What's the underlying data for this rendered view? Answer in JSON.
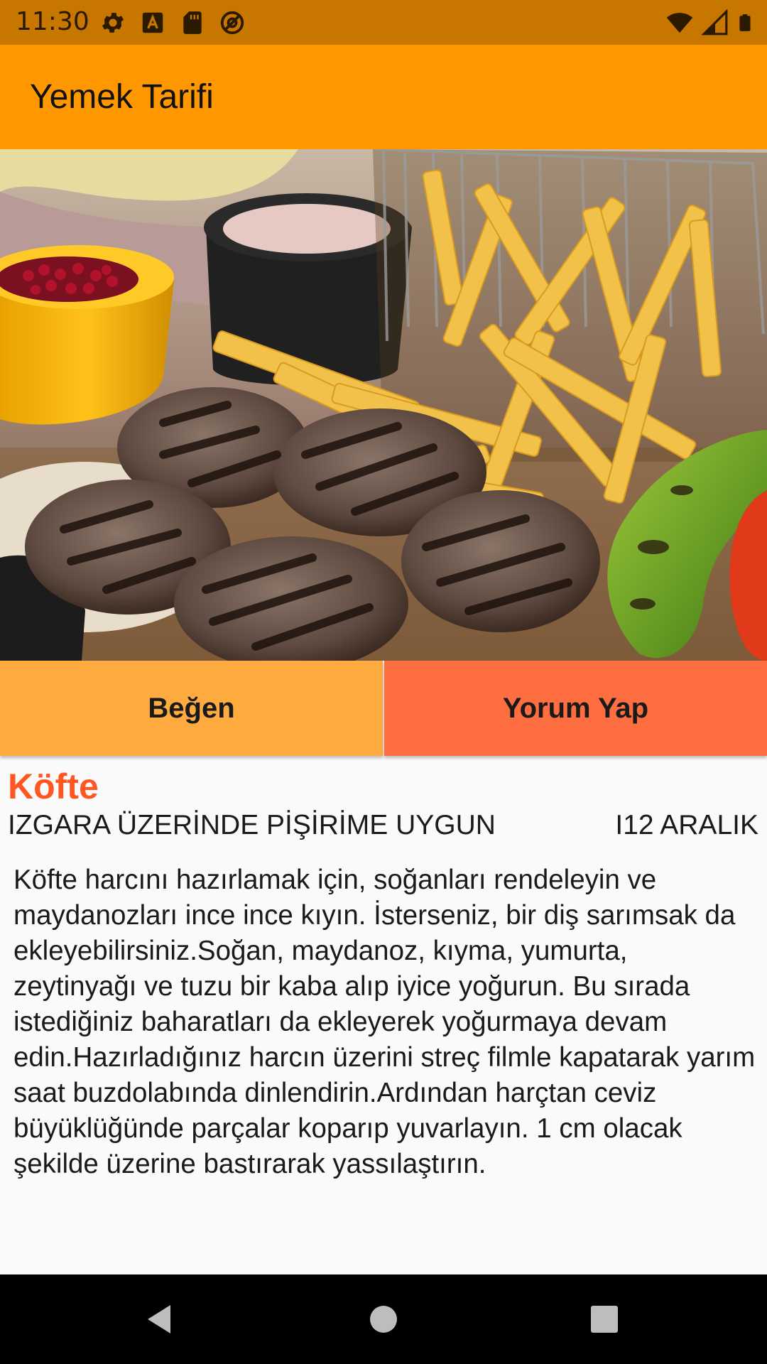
{
  "status_bar": {
    "time": "11:30",
    "left_icons": [
      "gear-icon",
      "a-icon",
      "sd-card-icon",
      "at-icon"
    ],
    "right_icons": [
      "wifi-icon",
      "signal-icon",
      "battery-icon"
    ],
    "color": "#C77700"
  },
  "app_bar": {
    "title": "Yemek Tarifi",
    "color": "#FF9800"
  },
  "actions": {
    "like_label": "Beğen",
    "comment_label": "Yorum Yap",
    "like_color": "#FFAB40",
    "comment_color": "#FF6E40"
  },
  "recipe": {
    "title": "Köfte",
    "subtitle": "IZGARA ÜZERİNDE PİŞİRİME UYGUN",
    "date": "I12 ARALIK",
    "description": "Köfte harcını hazırlamak için, soğanları rendeleyin ve maydanozları ince ince kıyın. İsterseniz, bir diş sarımsak da ekleyebilirsiniz.Soğan, maydanoz, kıyma, yumurta, zeytinyağı ve tuzu bir kaba alıp iyice yoğurun. Bu sırada istediğiniz baharatları da ekleyerek yoğurmaya devam edin.Hazırladığınız harcın üzerini streç filmle kapatarak yarım saat buzdolabında dinlendirin.Ardından harçtan ceviz büyüklüğünde parçalar koparıp yuvarlayın. 1 cm olacak şekilde üzerine bastırarak yassılaştırın.",
    "title_color": "#FF5722"
  },
  "nav_bar": {
    "icons": [
      "back-icon",
      "home-icon",
      "recents-icon"
    ]
  }
}
